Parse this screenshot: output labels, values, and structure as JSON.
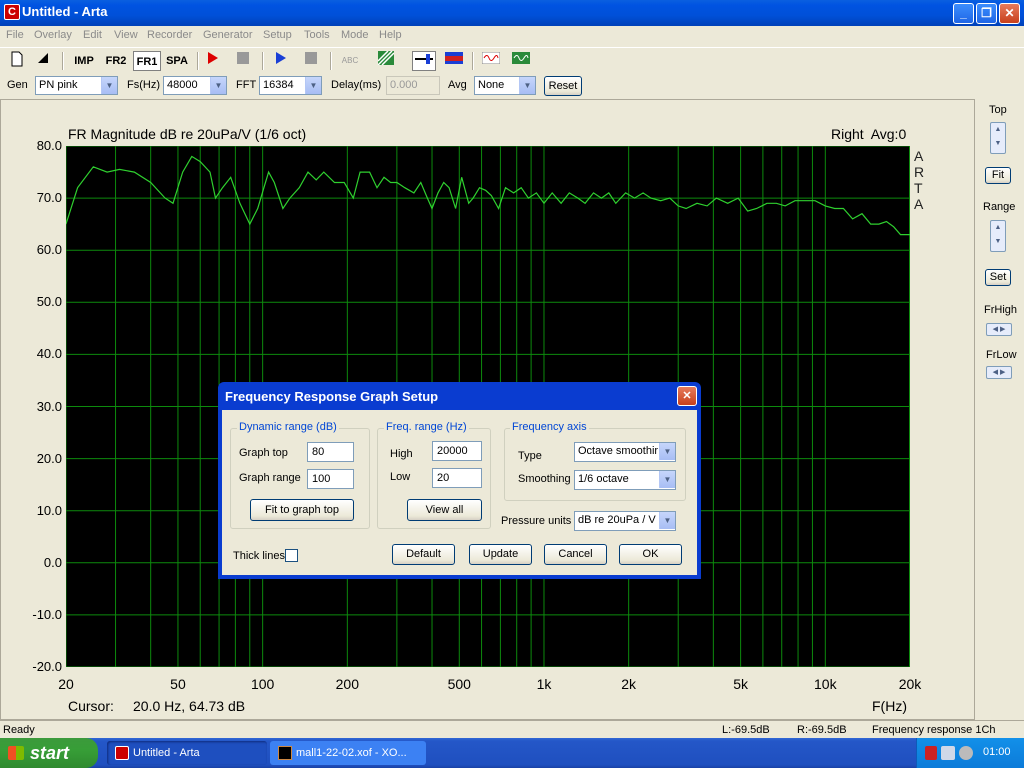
{
  "window": {
    "title": "Untitled - Arta",
    "minimize": "_",
    "restore": "❐",
    "close": "✕"
  },
  "menu": [
    "File",
    "Overlay",
    "Edit",
    "View",
    "Recorder",
    "Generator",
    "Setup",
    "Tools",
    "Mode",
    "Help"
  ],
  "toolbar": {
    "imp": "IMP",
    "fr2": "FR2",
    "fr1": "FR1",
    "spa": "SPA",
    "abc": "ABC"
  },
  "genbar": {
    "gen_label": "Gen",
    "gen_value": "PN pink",
    "fs_label": "Fs(Hz)",
    "fs_value": "48000",
    "fft_label": "FFT",
    "fft_value": "16384",
    "delay_label": "Delay(ms)",
    "delay_value": "0.000",
    "avg_label": "Avg",
    "avg_value": "None",
    "reset": "Reset"
  },
  "graph": {
    "title": "FR Magnitude dB re 20uPa/V (1/6 oct)",
    "channel": "Right  Avg:0",
    "arta": "A R T A",
    "cursor_label": "Cursor:",
    "cursor_value": "20.0 Hz, 64.73 dB",
    "xaxis_label": "F(Hz)"
  },
  "chart_data": {
    "type": "line",
    "title": "FR Magnitude dB re 20uPa/V (1/6 oct)",
    "xlabel": "F(Hz)",
    "ylabel": "",
    "xscale": "log",
    "xlim": [
      20,
      20000
    ],
    "ylim": [
      -20,
      80
    ],
    "xticks": [
      "20",
      "50",
      "100",
      "200",
      "500",
      "1k",
      "2k",
      "5k",
      "10k",
      "20k"
    ],
    "yticks": [
      "80.0",
      "70.0",
      "60.0",
      "50.0",
      "40.0",
      "30.0",
      "20.0",
      "10.0",
      "0.0",
      "-10.0",
      "-20.0"
    ],
    "line_color": "#2fd02f",
    "grid_color": "#0d8a0d",
    "grid": true,
    "series": [
      {
        "x": [
          20,
          22,
          25,
          28,
          31,
          35,
          40,
          45,
          48,
          52,
          56,
          60,
          65,
          68,
          72,
          77,
          83,
          90,
          96,
          101,
          105,
          110,
          118,
          125,
          135,
          145,
          155,
          165,
          180,
          195,
          210,
          222,
          240,
          255,
          270,
          285,
          300,
          320,
          345,
          365,
          385,
          400,
          420,
          440,
          460,
          485,
          510,
          540,
          560,
          590,
          620,
          650,
          690,
          730,
          780,
          830,
          880,
          940,
          1000,
          1070,
          1150,
          1230,
          1320,
          1400,
          1500,
          1600,
          1700,
          1800,
          1950,
          2100,
          2250,
          2400,
          2600,
          2800,
          3000,
          3200,
          3500,
          3800,
          4100,
          4500,
          4900,
          5300,
          5700,
          6200,
          6700,
          7200,
          7800,
          8500,
          9200,
          10000,
          10800,
          11600,
          12500,
          13500,
          14500,
          15500,
          16500,
          17500,
          18500,
          20000
        ],
        "y": [
          65,
          72,
          76,
          75,
          75.5,
          75,
          73,
          70,
          69,
          75,
          78,
          77,
          75,
          70,
          72,
          74,
          69,
          65,
          68,
          72,
          75,
          73,
          68,
          70,
          72,
          75,
          73.5,
          75,
          73,
          73,
          70,
          75,
          75,
          72,
          74,
          73,
          73,
          72,
          71,
          73,
          70,
          68,
          71,
          73,
          72,
          68,
          74,
          69,
          70,
          72,
          71.5,
          70.5,
          68,
          72,
          71,
          72,
          70,
          71,
          69,
          71,
          69,
          71,
          70,
          69,
          71,
          70,
          71,
          69,
          71,
          70,
          71,
          70,
          69.5,
          70,
          68.5,
          68,
          69,
          68.5,
          70,
          69,
          70,
          67.5,
          68,
          69,
          69,
          68.5,
          69.5,
          69.5,
          69.5,
          68.5,
          68,
          68,
          66,
          67,
          65,
          65,
          65.5,
          64.5,
          63,
          63
        ]
      }
    ]
  },
  "rpanel": {
    "top": "Top",
    "fit": "Fit",
    "range": "Range",
    "set": "Set",
    "frhigh": "FrHigh",
    "frlow": "FrLow"
  },
  "status": {
    "ready": "Ready",
    "l": "L:-69.5dB",
    "r": "R:-69.5dB",
    "mode": "Frequency response 1Ch"
  },
  "taskbar": {
    "start": "start",
    "task1": "Untitled - Arta",
    "task2": "mall1-22-02.xof - XO...",
    "clock": "01:00"
  },
  "dialog": {
    "title": "Frequency Response Graph Setup",
    "dyn_title": "Dynamic range (dB)",
    "graph_top_label": "Graph top",
    "graph_top": "80",
    "graph_range_label": "Graph range",
    "graph_range": "100",
    "fit_btn": "Fit to graph top",
    "freq_title": "Freq. range (Hz)",
    "high_label": "High",
    "high": "20000",
    "low_label": "Low",
    "low": "20",
    "viewall": "View all",
    "faxis_title": "Frequency axis",
    "type_label": "Type",
    "type_value": "Octave smoothir",
    "smooth_label": "Smoothing",
    "smooth_value": "1/6 octave",
    "pressure_label": "Pressure units",
    "pressure_value": "dB re 20uPa / V",
    "thick_label": "Thick lines",
    "default": "Default",
    "update": "Update",
    "cancel": "Cancel",
    "ok": "OK"
  }
}
